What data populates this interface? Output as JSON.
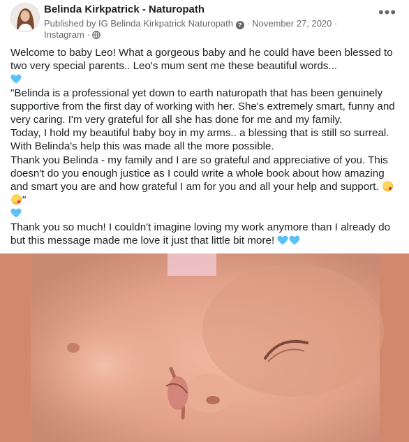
{
  "post": {
    "page_name": "Belinda Kirkpatrick - Naturopath",
    "published_by": "Published by IG Belinda Kirkpatrick Naturopath",
    "date": "November 27, 2020",
    "source": "Instagram",
    "separator": "·",
    "more_label": "•••",
    "lines": {
      "p1": "Welcome to baby Leo! What a gorgeous baby and he could have been blessed to two very special parents.. Leo's mum sent me these beautiful words...",
      "p2": "\"Belinda is a professional yet down to earth naturopath that has been genuinely supportive from the first day of working with her. She's extremely smart, funny and very caring. I'm very grateful for all she has done for me and my family.",
      "p3": "Today, I hold my beautiful baby boy in my arms.. a blessing that is still so surreal. With Belinda's help this was made all the more possible.",
      "p4": "Thank you Belinda - my family and I are so grateful and appreciative of you. This doesn't do you enough justice as I could write a whole book about how amazing and smart you are and how grateful I am for you and all your help and support.",
      "p4_close": "\"",
      "p5": "Thank you so much! I couldn't imagine loving my work anymore than I already do but this message made me love it just that little bit more!"
    },
    "colors": {
      "heart": "#5bc0f5",
      "photo_border": "#d0896d",
      "skin": "#e6a58c"
    }
  }
}
